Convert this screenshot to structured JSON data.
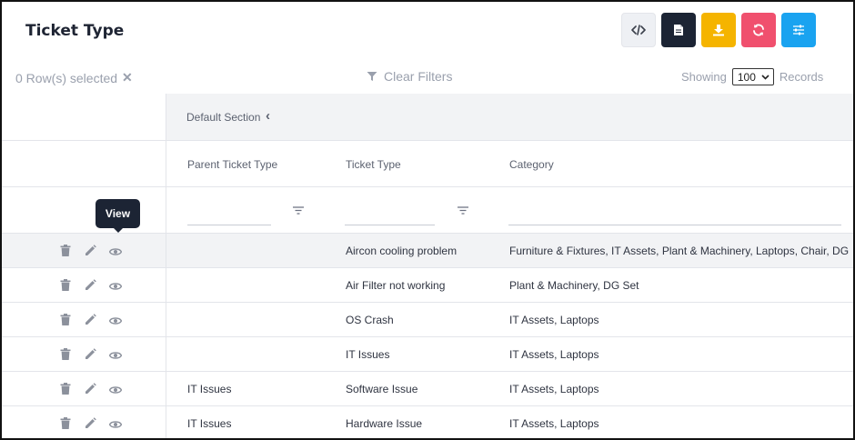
{
  "page": {
    "title": "Ticket Type"
  },
  "toolbar": {
    "buttons": [
      {
        "name": "code-view",
        "bg": "#eef0f4",
        "fg": "#3a3f4b"
      },
      {
        "name": "pdf-export",
        "bg": "#1c2434",
        "fg": "#ffffff"
      },
      {
        "name": "download",
        "bg": "#f5b400",
        "fg": "#ffffff"
      },
      {
        "name": "refresh",
        "bg": "#f0506e",
        "fg": "#ffffff"
      },
      {
        "name": "column-settings",
        "bg": "#1aa3f0",
        "fg": "#ffffff"
      }
    ]
  },
  "selection": {
    "text": "0 Row(s) selected",
    "clear_symbol": "✕"
  },
  "filters": {
    "clear_label": "Clear Filters"
  },
  "paging": {
    "showing_label": "Showing",
    "page_size": "100",
    "records_label": "Records"
  },
  "section": {
    "label": "Default Section",
    "chevron": "‹"
  },
  "columns": [
    "Parent Ticket Type",
    "Ticket Type",
    "Category"
  ],
  "tooltip": {
    "text": "View"
  },
  "rows": [
    {
      "parent": "",
      "ticket_type": "Aircon cooling problem",
      "category": "Furniture & Fixtures, IT Assets, Plant & Machinery, Laptops, Chair, DG"
    },
    {
      "parent": "",
      "ticket_type": "Air Filter not working",
      "category": "Plant & Machinery, DG Set"
    },
    {
      "parent": "",
      "ticket_type": "OS Crash",
      "category": "IT Assets, Laptops"
    },
    {
      "parent": "",
      "ticket_type": "IT Issues",
      "category": "IT Assets, Laptops"
    },
    {
      "parent": "IT Issues",
      "ticket_type": "Software Issue",
      "category": "IT Assets, Laptops"
    },
    {
      "parent": "IT Issues",
      "ticket_type": "Hardware Issue",
      "category": "IT Assets, Laptops"
    }
  ]
}
